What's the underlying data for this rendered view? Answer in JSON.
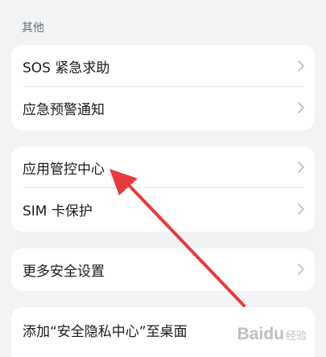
{
  "section": {
    "title": "其他"
  },
  "groups": [
    {
      "items": [
        {
          "label": "SOS 紧急求助"
        },
        {
          "label": "应急预警通知"
        }
      ]
    },
    {
      "items": [
        {
          "label": "应用管控中心"
        },
        {
          "label": "SIM 卡保护"
        }
      ]
    },
    {
      "items": [
        {
          "label": "更多安全设置"
        }
      ]
    },
    {
      "items": [
        {
          "label": "添加“安全隐私中心”至桌面"
        }
      ]
    }
  ],
  "annotation": {
    "arrow_color": "#e83a3a"
  },
  "watermark": {
    "brand": "Baidu",
    "suffix": "经验"
  },
  "colors": {
    "background": "#f1f3f5",
    "card": "#ffffff",
    "text": "#1a1a1a",
    "chevron": "#b9bcc0"
  },
  "icons": {
    "row_chevron": "chevron-right-icon"
  }
}
